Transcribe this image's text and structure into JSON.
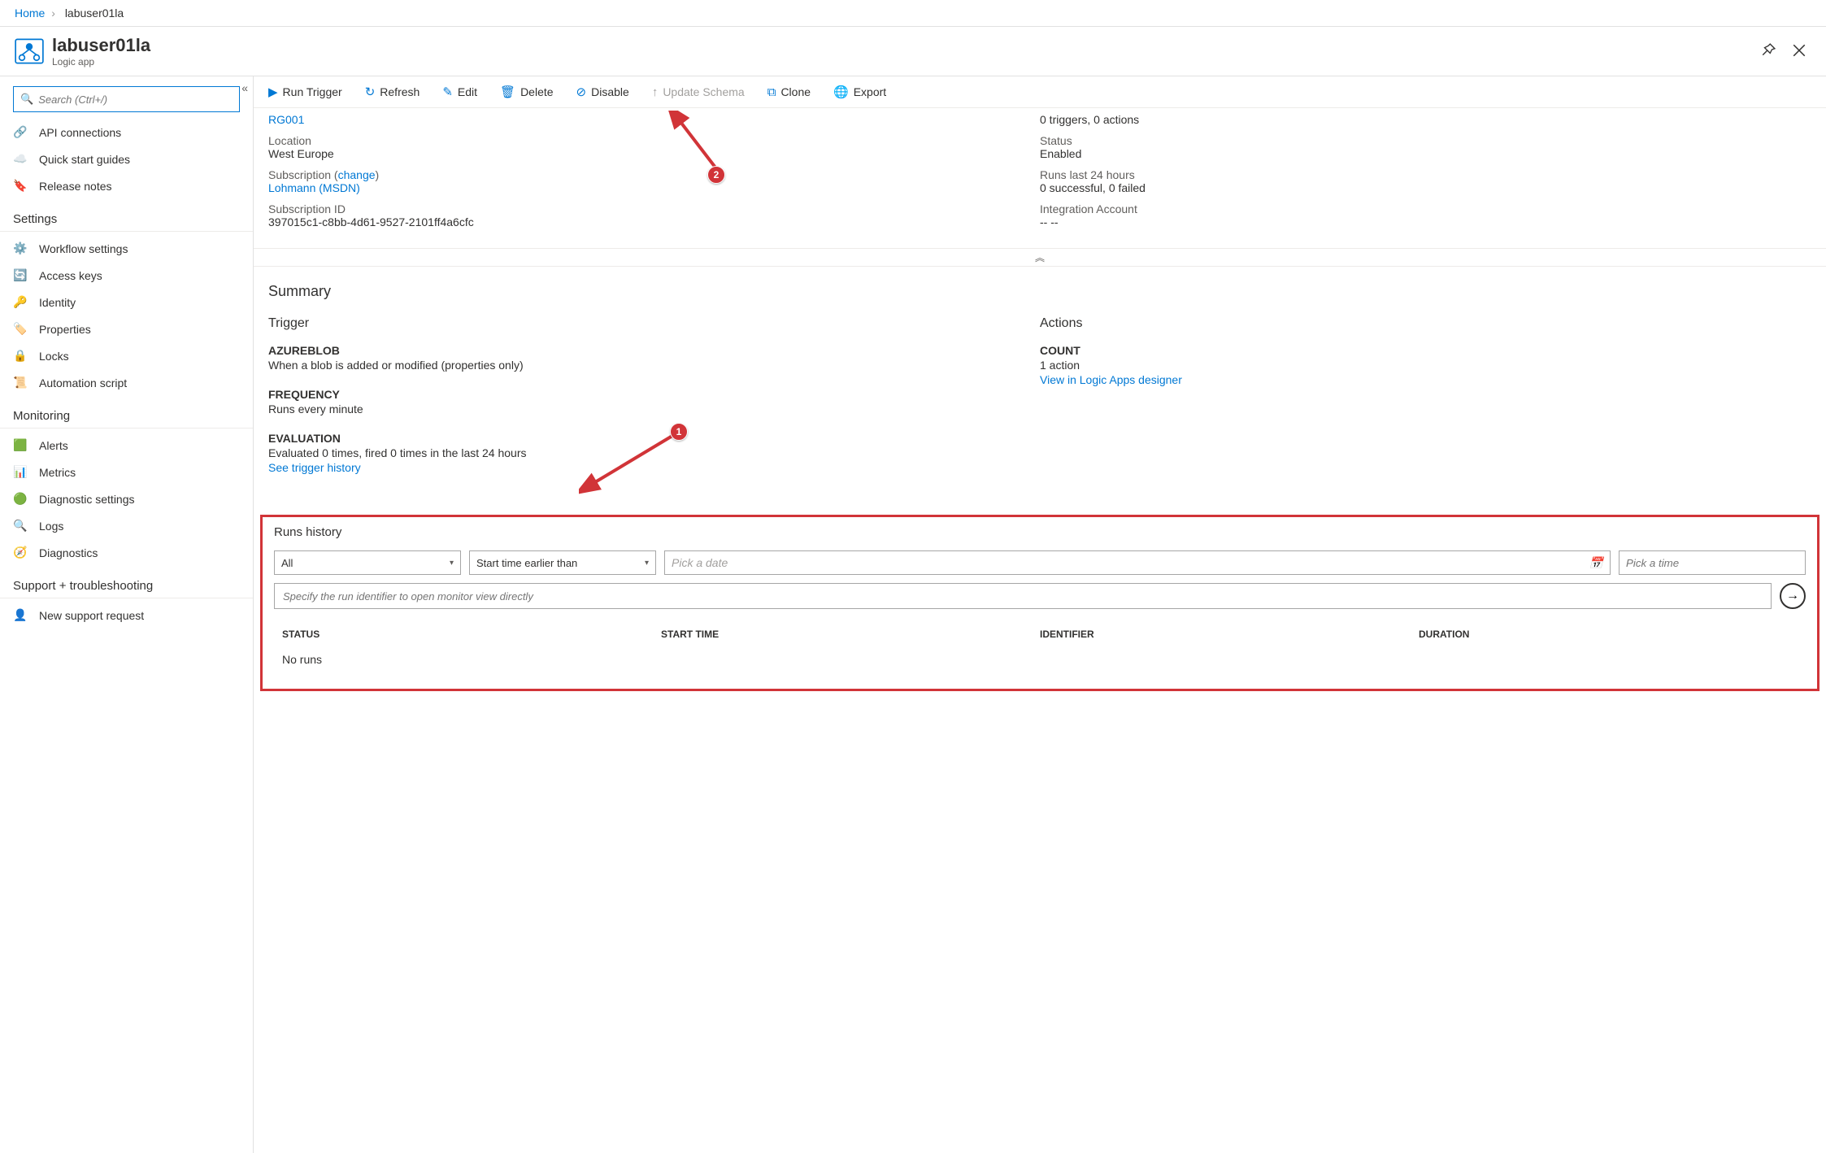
{
  "breadcrumb": {
    "home": "Home",
    "current": "labuser01la"
  },
  "header": {
    "title": "labuser01la",
    "subtitle": "Logic app"
  },
  "search": {
    "placeholder": "Search (Ctrl+/)"
  },
  "nav": {
    "top": [
      {
        "label": "API connections"
      },
      {
        "label": "Quick start guides"
      },
      {
        "label": "Release notes"
      }
    ],
    "settings_title": "Settings",
    "settings": [
      {
        "label": "Workflow settings"
      },
      {
        "label": "Access keys"
      },
      {
        "label": "Identity"
      },
      {
        "label": "Properties"
      },
      {
        "label": "Locks"
      },
      {
        "label": "Automation script"
      }
    ],
    "monitoring_title": "Monitoring",
    "monitoring": [
      {
        "label": "Alerts"
      },
      {
        "label": "Metrics"
      },
      {
        "label": "Diagnostic settings"
      },
      {
        "label": "Logs"
      },
      {
        "label": "Diagnostics"
      }
    ],
    "support_title": "Support + troubleshooting",
    "support": [
      {
        "label": "New support request"
      }
    ]
  },
  "toolbar": {
    "run": "Run Trigger",
    "refresh": "Refresh",
    "edit": "Edit",
    "delete": "Delete",
    "disable": "Disable",
    "update": "Update Schema",
    "clone": "Clone",
    "export": "Export"
  },
  "annotations": {
    "badge1": "1",
    "badge2": "2"
  },
  "essentials": {
    "rg_value": "RG001",
    "location_label": "Location",
    "location_value": "West Europe",
    "subscription_label": "Subscription",
    "subscription_change": "change",
    "subscription_value": "Lohmann (MSDN)",
    "subid_label": "Subscription ID",
    "subid_value": "397015c1-c8bb-4d61-9527-2101ff4a6cfc",
    "definition_value": "0 triggers, 0 actions",
    "status_label": "Status",
    "status_value": "Enabled",
    "runs24_label": "Runs last 24 hours",
    "runs24_value": "0 successful, 0 failed",
    "intacc_label": "Integration Account",
    "intacc_value": "-- --"
  },
  "summary": {
    "title": "Summary",
    "trigger_title": "Trigger",
    "azureblob_label": "AZUREBLOB",
    "azureblob_value": "When a blob is added or modified (properties only)",
    "frequency_label": "FREQUENCY",
    "frequency_value": "Runs every minute",
    "evaluation_label": "EVALUATION",
    "evaluation_value": "Evaluated 0 times, fired 0 times in the last 24 hours",
    "see_history": "See trigger history",
    "actions_title": "Actions",
    "count_label": "COUNT",
    "count_value": "1 action",
    "designer_link": "View in Logic Apps designer"
  },
  "runs": {
    "title": "Runs history",
    "filter_all": "All",
    "filter_start": "Start time earlier than",
    "pick_date": "Pick a date",
    "pick_time": "Pick a time",
    "run_id_ph": "Specify the run identifier to open monitor view directly",
    "col_status": "STATUS",
    "col_start": "START TIME",
    "col_id": "IDENTIFIER",
    "col_dur": "DURATION",
    "empty": "No runs"
  }
}
